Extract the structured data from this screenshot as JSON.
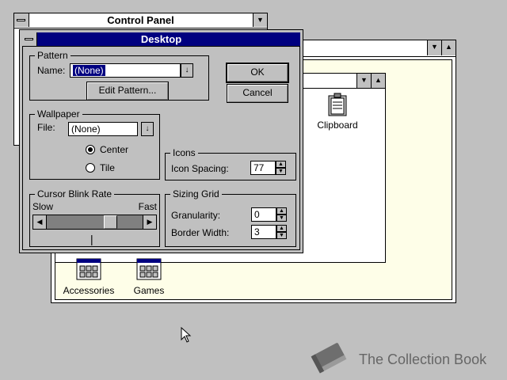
{
  "control_panel": {
    "title": "Control Panel"
  },
  "program_manager": {
    "groups": [
      {
        "label": "Accessories"
      },
      {
        "label": "Games"
      }
    ],
    "clipboard_label": "Clipboard"
  },
  "desktop_dialog": {
    "title": "Desktop",
    "pattern": {
      "group_label": "Pattern",
      "name_label": "Name:",
      "name_value": "(None)",
      "edit_button": "Edit Pattern..."
    },
    "ok_button": "OK",
    "cancel_button": "Cancel",
    "wallpaper": {
      "group_label": "Wallpaper",
      "file_label": "File:",
      "file_value": "(None)",
      "center_label": "Center",
      "tile_label": "Tile",
      "selected": "center"
    },
    "icons": {
      "group_label": "Icons",
      "spacing_label": "Icon Spacing:",
      "spacing_value": "77"
    },
    "cursor_blink": {
      "group_label": "Cursor Blink Rate",
      "slow_label": "Slow",
      "fast_label": "Fast",
      "cursor_glyph": "|",
      "rate_fraction": 0.7
    },
    "sizing_grid": {
      "group_label": "Sizing Grid",
      "granularity_label": "Granularity:",
      "granularity_value": "0",
      "border_label": "Border Width:",
      "border_value": "3"
    }
  },
  "watermark": {
    "text": "The Collection Book"
  },
  "colors": {
    "active_title": "#000080",
    "face": "#c0c0c0",
    "desktop": "#c0c0c0",
    "group_bg": "#fefee8"
  }
}
